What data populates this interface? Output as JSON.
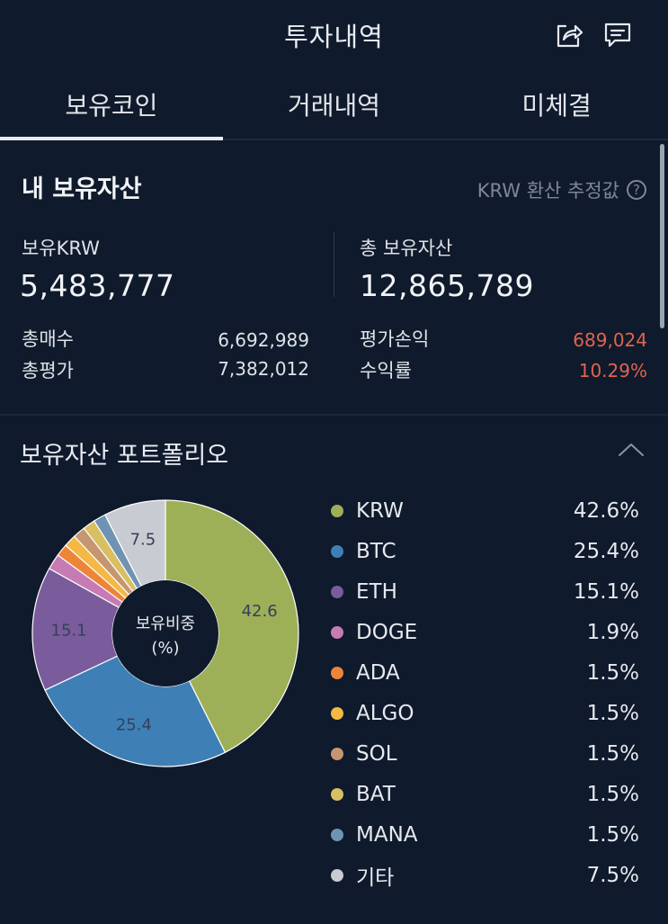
{
  "header": {
    "title": "투자내역",
    "share_icon": "share-icon",
    "comment_icon": "comment-icon"
  },
  "tabs": [
    {
      "label": "보유코인",
      "active": true
    },
    {
      "label": "거래내역",
      "active": false
    },
    {
      "label": "미체결",
      "active": false
    }
  ],
  "assets": {
    "title": "내 보유자산",
    "estimate_label": "KRW 환산 추정값",
    "help_symbol": "?",
    "krw_label": "보유KRW",
    "krw_value": "5,483,777",
    "total_label": "총 보유자산",
    "total_value": "12,865,789",
    "buy_label": "총매수",
    "buy_value": "6,692,989",
    "eval_label": "총평가",
    "eval_value": "7,382,012",
    "pnl_label": "평가손익",
    "pnl_value": "689,024",
    "roi_label": "수익률",
    "roi_value": "10.29%"
  },
  "portfolio": {
    "title": "보유자산 포트폴리오",
    "center_label_line1": "보유비중",
    "center_label_line2": "(%)",
    "colors": {
      "positive": "#e0644f",
      "accent": "#e8ebef"
    }
  },
  "chart_data": {
    "type": "pie",
    "title": "",
    "categories": [
      "KRW",
      "BTC",
      "ETH",
      "DOGE",
      "ADA",
      "ALGO",
      "SOL",
      "BAT",
      "MANA",
      "기타"
    ],
    "values": [
      42.6,
      25.4,
      15.1,
      1.9,
      1.5,
      1.5,
      1.5,
      1.5,
      1.5,
      7.5
    ],
    "labels": [
      "42.6%",
      "25.4%",
      "15.1%",
      "1.9%",
      "1.5%",
      "1.5%",
      "1.5%",
      "1.5%",
      "1.5%",
      "7.5%"
    ],
    "slice_labels": [
      "42.6",
      "25.4",
      "15.1",
      "",
      "",
      "",
      "",
      "",
      "",
      "7.5"
    ],
    "colors": [
      "#9db058",
      "#3e80b5",
      "#7a5b9c",
      "#c77bb4",
      "#ec8538",
      "#f4b944",
      "#c59670",
      "#d8bf62",
      "#6f93b2",
      "#c8cbd1"
    ],
    "legend": "right"
  }
}
